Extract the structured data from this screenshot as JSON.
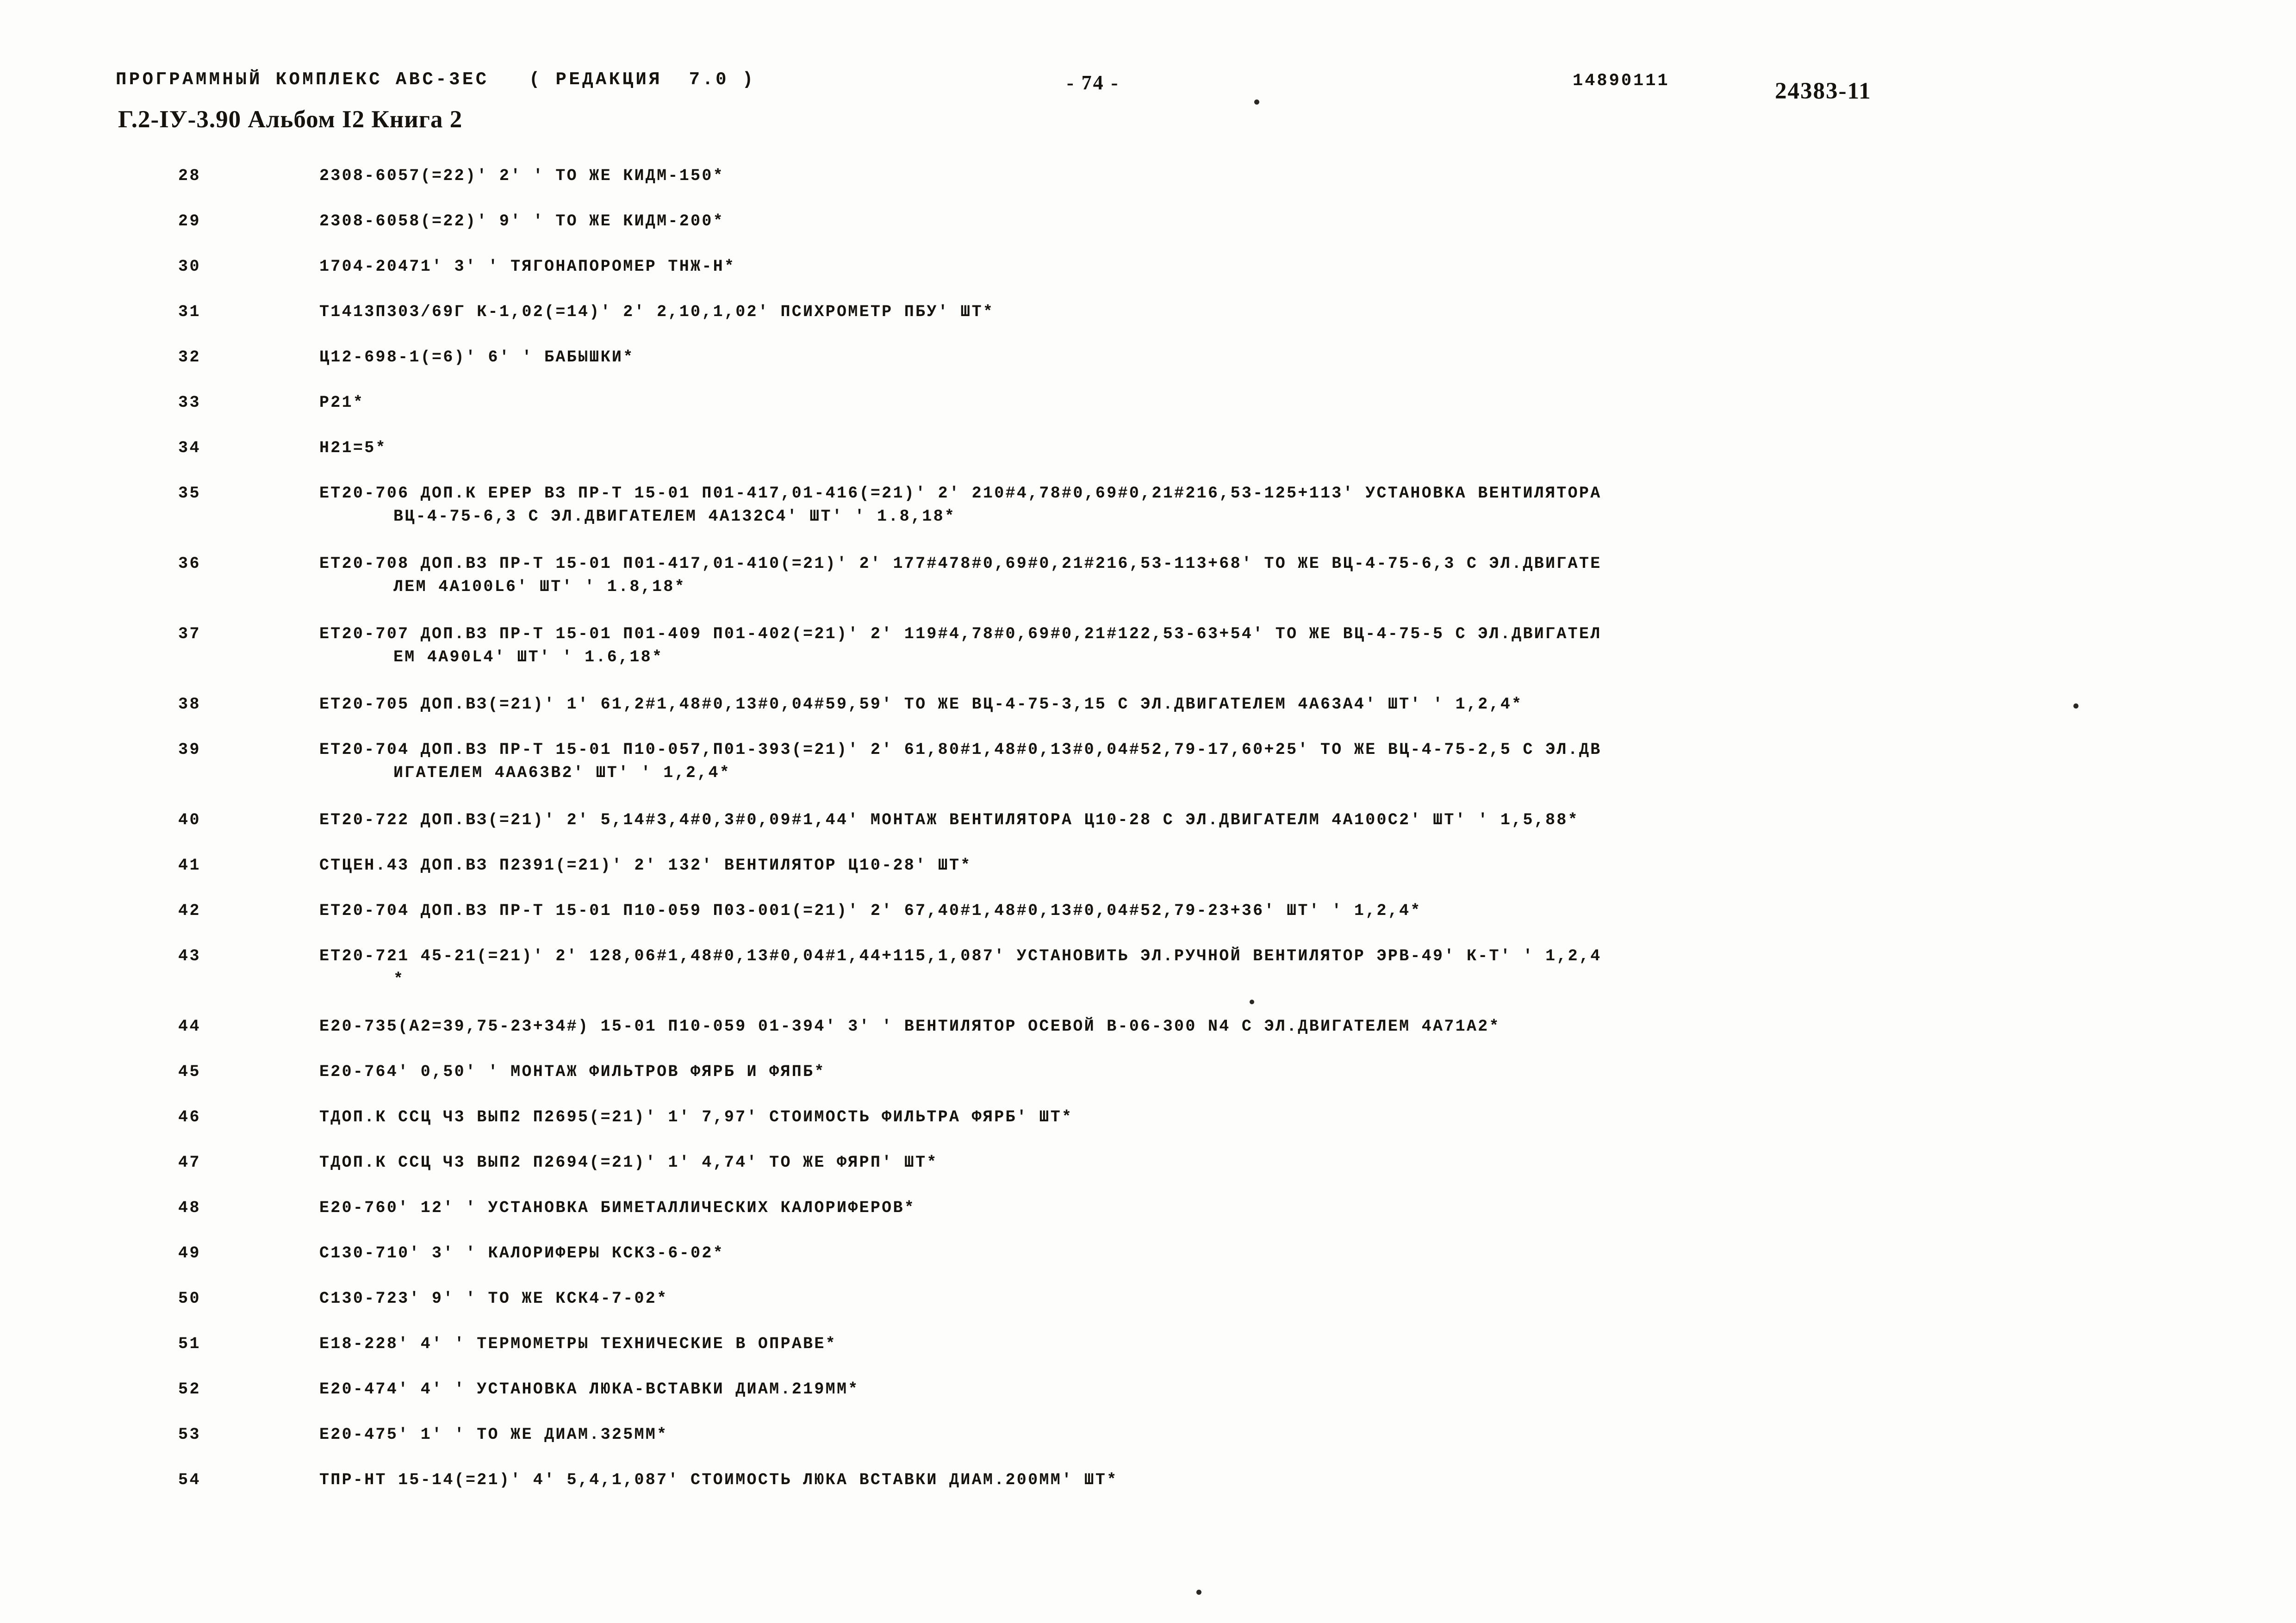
{
  "header": {
    "program_title": "ПРОГРАММНЫЙ КОМПЛЕКС АВС-3ЕС   ( РЕДАКЦИЯ  7.0 )",
    "album_line": "Г.2-IУ-3.90 Альбом I2 Книга 2",
    "page_number": "- 74 -",
    "doc_code": "14890111",
    "stamp_code": "24383-11"
  },
  "listing": {
    "rows": [
      {
        "num": "28",
        "text": "2308-6057(=22)' 2' ' ТО ЖЕ КИДМ-150*",
        "cont": ""
      },
      {
        "num": "29",
        "text": "2308-6058(=22)' 9' ' ТО ЖЕ КИДМ-200*",
        "cont": ""
      },
      {
        "num": "30",
        "text": "1704-20471' 3' ' ТЯГОНАПОРОМЕР ТНЖ-Н*",
        "cont": ""
      },
      {
        "num": "31",
        "text": "Т1413П303/69Г К-1,02(=14)' 2' 2,10,1,02' ПСИХРОМЕТР ПБУ' ШТ*",
        "cont": ""
      },
      {
        "num": "32",
        "text": "Ц12-698-1(=6)' 6' ' БАБЫШКИ*",
        "cont": ""
      },
      {
        "num": "33",
        "text": "Р21*",
        "cont": ""
      },
      {
        "num": "34",
        "text": "Н21=5*",
        "cont": ""
      },
      {
        "num": "35",
        "text": "ЕТ20-706 ДОП.К ЕРЕР ВЗ ПР-Т 15-01 П01-417,01-416(=21)' 2' 210#4,78#0,69#0,21#216,53-125+113' УСТАНОВКА ВЕНТИЛЯТОРА",
        "cont": "ВЦ-4-75-6,3 С ЭЛ.ДВИГАТЕЛЕМ 4А132С4' ШТ' ' 1.8,18*"
      },
      {
        "num": "36",
        "text": "ЕТ20-708 ДОП.ВЗ ПР-Т 15-01 П01-417,01-410(=21)' 2' 177#478#0,69#0,21#216,53-113+68' ТО ЖЕ ВЦ-4-75-6,3 С ЭЛ.ДВИГАТЕ",
        "cont": "ЛЕМ 4А100L6' ШТ' ' 1.8,18*"
      },
      {
        "num": "37",
        "text": "ЕТ20-707 ДОП.ВЗ ПР-Т 15-01 П01-409 П01-402(=21)' 2' 119#4,78#0,69#0,21#122,53-63+54' ТО ЖЕ ВЦ-4-75-5 С ЭЛ.ДВИГАТЕЛ",
        "cont": "ЕМ 4А90L4' ШТ' ' 1.6,18*"
      },
      {
        "num": "38",
        "text": "ЕТ20-705 ДОП.ВЗ(=21)' 1' 61,2#1,48#0,13#0,04#59,59' ТО ЖЕ ВЦ-4-75-3,15 С ЭЛ.ДВИГАТЕЛЕМ 4А63А4' ШТ' ' 1,2,4*",
        "cont": ""
      },
      {
        "num": "39",
        "text": "ЕТ20-704 ДОП.ВЗ ПР-Т 15-01 П10-057,П01-393(=21)' 2' 61,80#1,48#0,13#0,04#52,79-17,60+25' ТО ЖЕ ВЦ-4-75-2,5 С ЭЛ.ДВ",
        "cont": "ИГАТЕЛЕМ 4АА63В2' ШТ' ' 1,2,4*"
      },
      {
        "num": "40",
        "text": "ЕТ20-722 ДОП.ВЗ(=21)' 2' 5,14#3,4#0,3#0,09#1,44' МОНТАЖ ВЕНТИЛЯТОРА Ц10-28 С ЭЛ.ДВИГАТЕЛМ 4А100С2' ШТ' ' 1,5,88*",
        "cont": ""
      },
      {
        "num": "41",
        "text": "СТЦЕН.43 ДОП.ВЗ П2391(=21)' 2' 132' ВЕНТИЛЯТОР Ц10-28' ШТ*",
        "cont": ""
      },
      {
        "num": "42",
        "text": "ЕТ20-704 ДОП.ВЗ ПР-Т 15-01 П10-059 П03-001(=21)' 2' 67,40#1,48#0,13#0,04#52,79-23+36' ШТ' ' 1,2,4*",
        "cont": ""
      },
      {
        "num": "43",
        "text": "ЕТ20-721 45-21(=21)' 2' 128,06#1,48#0,13#0,04#1,44+115,1,087' УСТАНОВИТЬ ЭЛ.РУЧНОЙ ВЕНТИЛЯТОР ЭРВ-49' К-Т' ' 1,2,4",
        "cont": "*"
      },
      {
        "num": "44",
        "text": "Е20-735(А2=39,75-23+34#) 15-01 П10-059 01-394' 3' ' ВЕНТИЛЯТОР ОСЕВОЙ В-06-300 N4 С ЭЛ.ДВИГАТЕЛЕМ 4А71А2*",
        "cont": ""
      },
      {
        "num": "45",
        "text": "Е20-764' 0,50' ' МОНТАЖ ФИЛЬТРОВ ФЯРБ И ФЯПБ*",
        "cont": ""
      },
      {
        "num": "46",
        "text": "ТДОП.К ССЦ Ч3 ВЫП2 П2695(=21)' 1' 7,97' СТОИМОСТЬ ФИЛЬТРА ФЯРБ' ШТ*",
        "cont": ""
      },
      {
        "num": "47",
        "text": "ТДОП.К ССЦ Ч3 ВЫП2 П2694(=21)' 1' 4,74' ТО ЖЕ ФЯРП' ШТ*",
        "cont": ""
      },
      {
        "num": "48",
        "text": "Е20-760' 12' ' УСТАНОВКА БИМЕТАЛЛИЧЕСКИХ КАЛОРИФЕРОВ*",
        "cont": ""
      },
      {
        "num": "49",
        "text": "С130-710' 3' ' КАЛОРИФЕРЫ КСК3-6-02*",
        "cont": ""
      },
      {
        "num": "50",
        "text": "С130-723' 9' ' ТО ЖЕ КСК4-7-02*",
        "cont": ""
      },
      {
        "num": "51",
        "text": "Е18-228' 4' ' ТЕРМОМЕТРЫ ТЕХНИЧЕСКИЕ В ОПРАВЕ*",
        "cont": ""
      },
      {
        "num": "52",
        "text": "Е20-474' 4' ' УСТАНОВКА ЛЮКА-ВСТАВКИ ДИАМ.219ММ*",
        "cont": ""
      },
      {
        "num": "53",
        "text": "Е20-475' 1' ' ТО ЖЕ ДИАМ.325ММ*",
        "cont": ""
      },
      {
        "num": "54",
        "text": "ТПР-НТ 15-14(=21)' 4' 5,4,1,087' СТОИМОСТЬ ЛЮКА ВСТАВКИ ДИАМ.200ММ' ШТ*",
        "cont": ""
      }
    ]
  }
}
